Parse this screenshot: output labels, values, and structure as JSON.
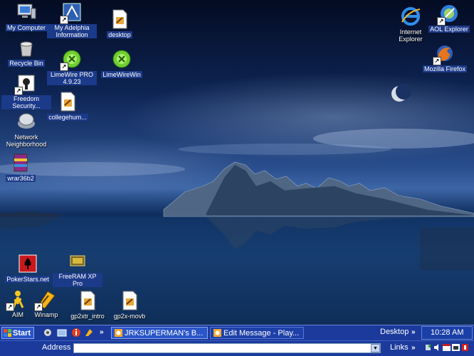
{
  "desktop_icons_left": [
    {
      "id": "my-computer",
      "label": "My Computer",
      "icon": "computer-icon",
      "shortcut": false
    },
    {
      "id": "my-adelphia",
      "label": "My Adelphia Information",
      "icon": "adelphia-icon",
      "shortcut": true
    },
    {
      "id": "desktop-file",
      "label": "desktop",
      "icon": "document-icon",
      "shortcut": false
    },
    {
      "id": "recycle-bin",
      "label": "Recycle Bin",
      "icon": "recycle-bin-icon",
      "shortcut": false
    },
    {
      "id": "limewire-pro",
      "label": "LimeWire PRO 4.9.23",
      "icon": "limewire-icon",
      "shortcut": true
    },
    {
      "id": "limewirewin",
      "label": "LimeWireWin",
      "icon": "limewire-icon",
      "shortcut": false
    },
    {
      "id": "freedom-security",
      "label": "Freedom Security...",
      "icon": "freedom-icon",
      "shortcut": true
    },
    {
      "id": "collegehum",
      "label": "collegehum...",
      "icon": "document-icon",
      "shortcut": false
    },
    {
      "id": "network",
      "label": "Network Neighborhood",
      "icon": "network-icon",
      "shortcut": false
    },
    {
      "id": "wrar",
      "label": "wrar36b2",
      "icon": "winrar-icon",
      "shortcut": false
    },
    {
      "id": "pokerstars",
      "label": "PokerStars.net",
      "icon": "pokerstars-icon",
      "shortcut": false
    },
    {
      "id": "freeram",
      "label": "FreeRAM XP Pro",
      "icon": "freeram-icon",
      "shortcut": false
    },
    {
      "id": "aim",
      "label": "AIM",
      "icon": "aim-icon",
      "shortcut": true
    },
    {
      "id": "winamp",
      "label": "Winamp",
      "icon": "winamp-icon",
      "shortcut": true
    },
    {
      "id": "gp2xtr",
      "label": "gp2xtr_intro",
      "icon": "document-icon",
      "shortcut": false
    },
    {
      "id": "gp2xmovb",
      "label": "gp2x-movb",
      "icon": "document-icon",
      "shortcut": false
    }
  ],
  "desktop_icons_right": [
    {
      "id": "ie",
      "label": "Internet Explorer",
      "icon": "internet-explorer-icon",
      "shortcut": false
    },
    {
      "id": "aol",
      "label": "AOL Explorer",
      "icon": "aol-explorer-icon",
      "shortcut": true
    },
    {
      "id": "firefox",
      "label": "Mozilla Firefox",
      "icon": "firefox-icon",
      "shortcut": true
    }
  ],
  "taskbar": {
    "start_label": "Start",
    "chevron": "»",
    "tasks": [
      {
        "label": "JRKSUPERMAN's B...",
        "icon": "browser-icon"
      },
      {
        "label": "Edit Message - Play...",
        "icon": "browser-icon"
      }
    ],
    "desktop_toolbar": "Desktop",
    "clock": "10:28 AM"
  },
  "address_bar": {
    "label": "Address",
    "value": "",
    "links_label": "Links"
  },
  "colors": {
    "taskbar": "#1b3a9c",
    "selection": "#1c3a8a"
  }
}
